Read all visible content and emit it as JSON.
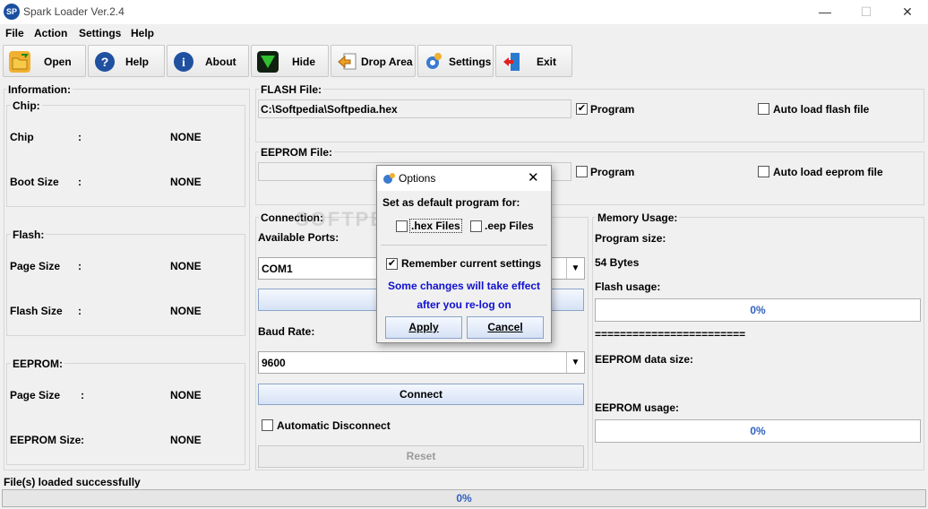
{
  "window": {
    "title": "Spark Loader Ver.2.4",
    "app_icon": "SP",
    "minimize": "—",
    "maximize": "☐",
    "close": "✕"
  },
  "menu": {
    "file": "File",
    "action": "Action",
    "settings": "Settings",
    "help": "Help"
  },
  "toolbar": {
    "open": "Open",
    "help": "Help",
    "about": "About",
    "hide": "Hide",
    "drop_area": "Drop Area",
    "settings": "Settings",
    "exit": "Exit"
  },
  "info": {
    "title": "Information:",
    "chip_group": "Chip:",
    "chip_label": "Chip",
    "chip_value": "NONE",
    "boot_label": "Boot Size",
    "boot_value": "NONE",
    "flash_group": "Flash:",
    "flash_page_label": "Page Size",
    "flash_page_value": "NONE",
    "flash_size_label": "Flash Size",
    "flash_size_value": "NONE",
    "eeprom_group": "EEPROM:",
    "eeprom_page_label": "Page Size",
    "eeprom_page_value": "NONE",
    "eeprom_size_label": "EEPROM Size",
    "eeprom_size_value": "NONE",
    "colon": ":"
  },
  "flash_file": {
    "title": "FLASH File:",
    "path": "C:\\Softpedia\\Softpedia.hex",
    "program_label": "Program",
    "program_checked": true,
    "autoload_label": "Auto load flash file",
    "autoload_checked": false
  },
  "eeprom_file": {
    "title": "EEPROM File:",
    "path": "",
    "program_label": "Program",
    "program_checked": false,
    "autoload_label": "Auto load eeprom file",
    "autoload_checked": false
  },
  "connection": {
    "title": "Connection:",
    "ports_label": "Available Ports:",
    "port_value": "COM1",
    "baud_label": "Baud Rate:",
    "baud_value": "9600",
    "connect_label": "Connect",
    "auto_disconnect_label": "Automatic Disconnect",
    "auto_disconnect_checked": false,
    "reset_label": "Reset"
  },
  "memory": {
    "title": "Memory Usage:",
    "program_size_label": "Program size:",
    "program_size_value": "54 Bytes",
    "flash_usage_label": "Flash usage:",
    "flash_usage_pct": "0%",
    "separator": "========================",
    "eeprom_data_label": "EEPROM data size:",
    "eeprom_usage_label": "EEPROM usage:",
    "eeprom_usage_pct": "0%"
  },
  "status": {
    "text": "File(s) loaded successfully",
    "progress_pct": "0%",
    "progress_value": 0
  },
  "dialog": {
    "title": "Options",
    "close": "✕",
    "default_label": "Set as default program for:",
    "hex_label": ".hex Files",
    "hex_checked": false,
    "eep_label": ".eep Files",
    "eep_checked": false,
    "remember_label": "Remember current settings",
    "remember_checked": true,
    "notice_line1": "Some changes will take effect",
    "notice_line2": "after you re-log on",
    "apply": "Apply",
    "cancel": "Cancel"
  },
  "watermark": "SOFTPEDIA",
  "colors": {
    "accent": "#1010d0",
    "progress_text": "#3060c0"
  }
}
